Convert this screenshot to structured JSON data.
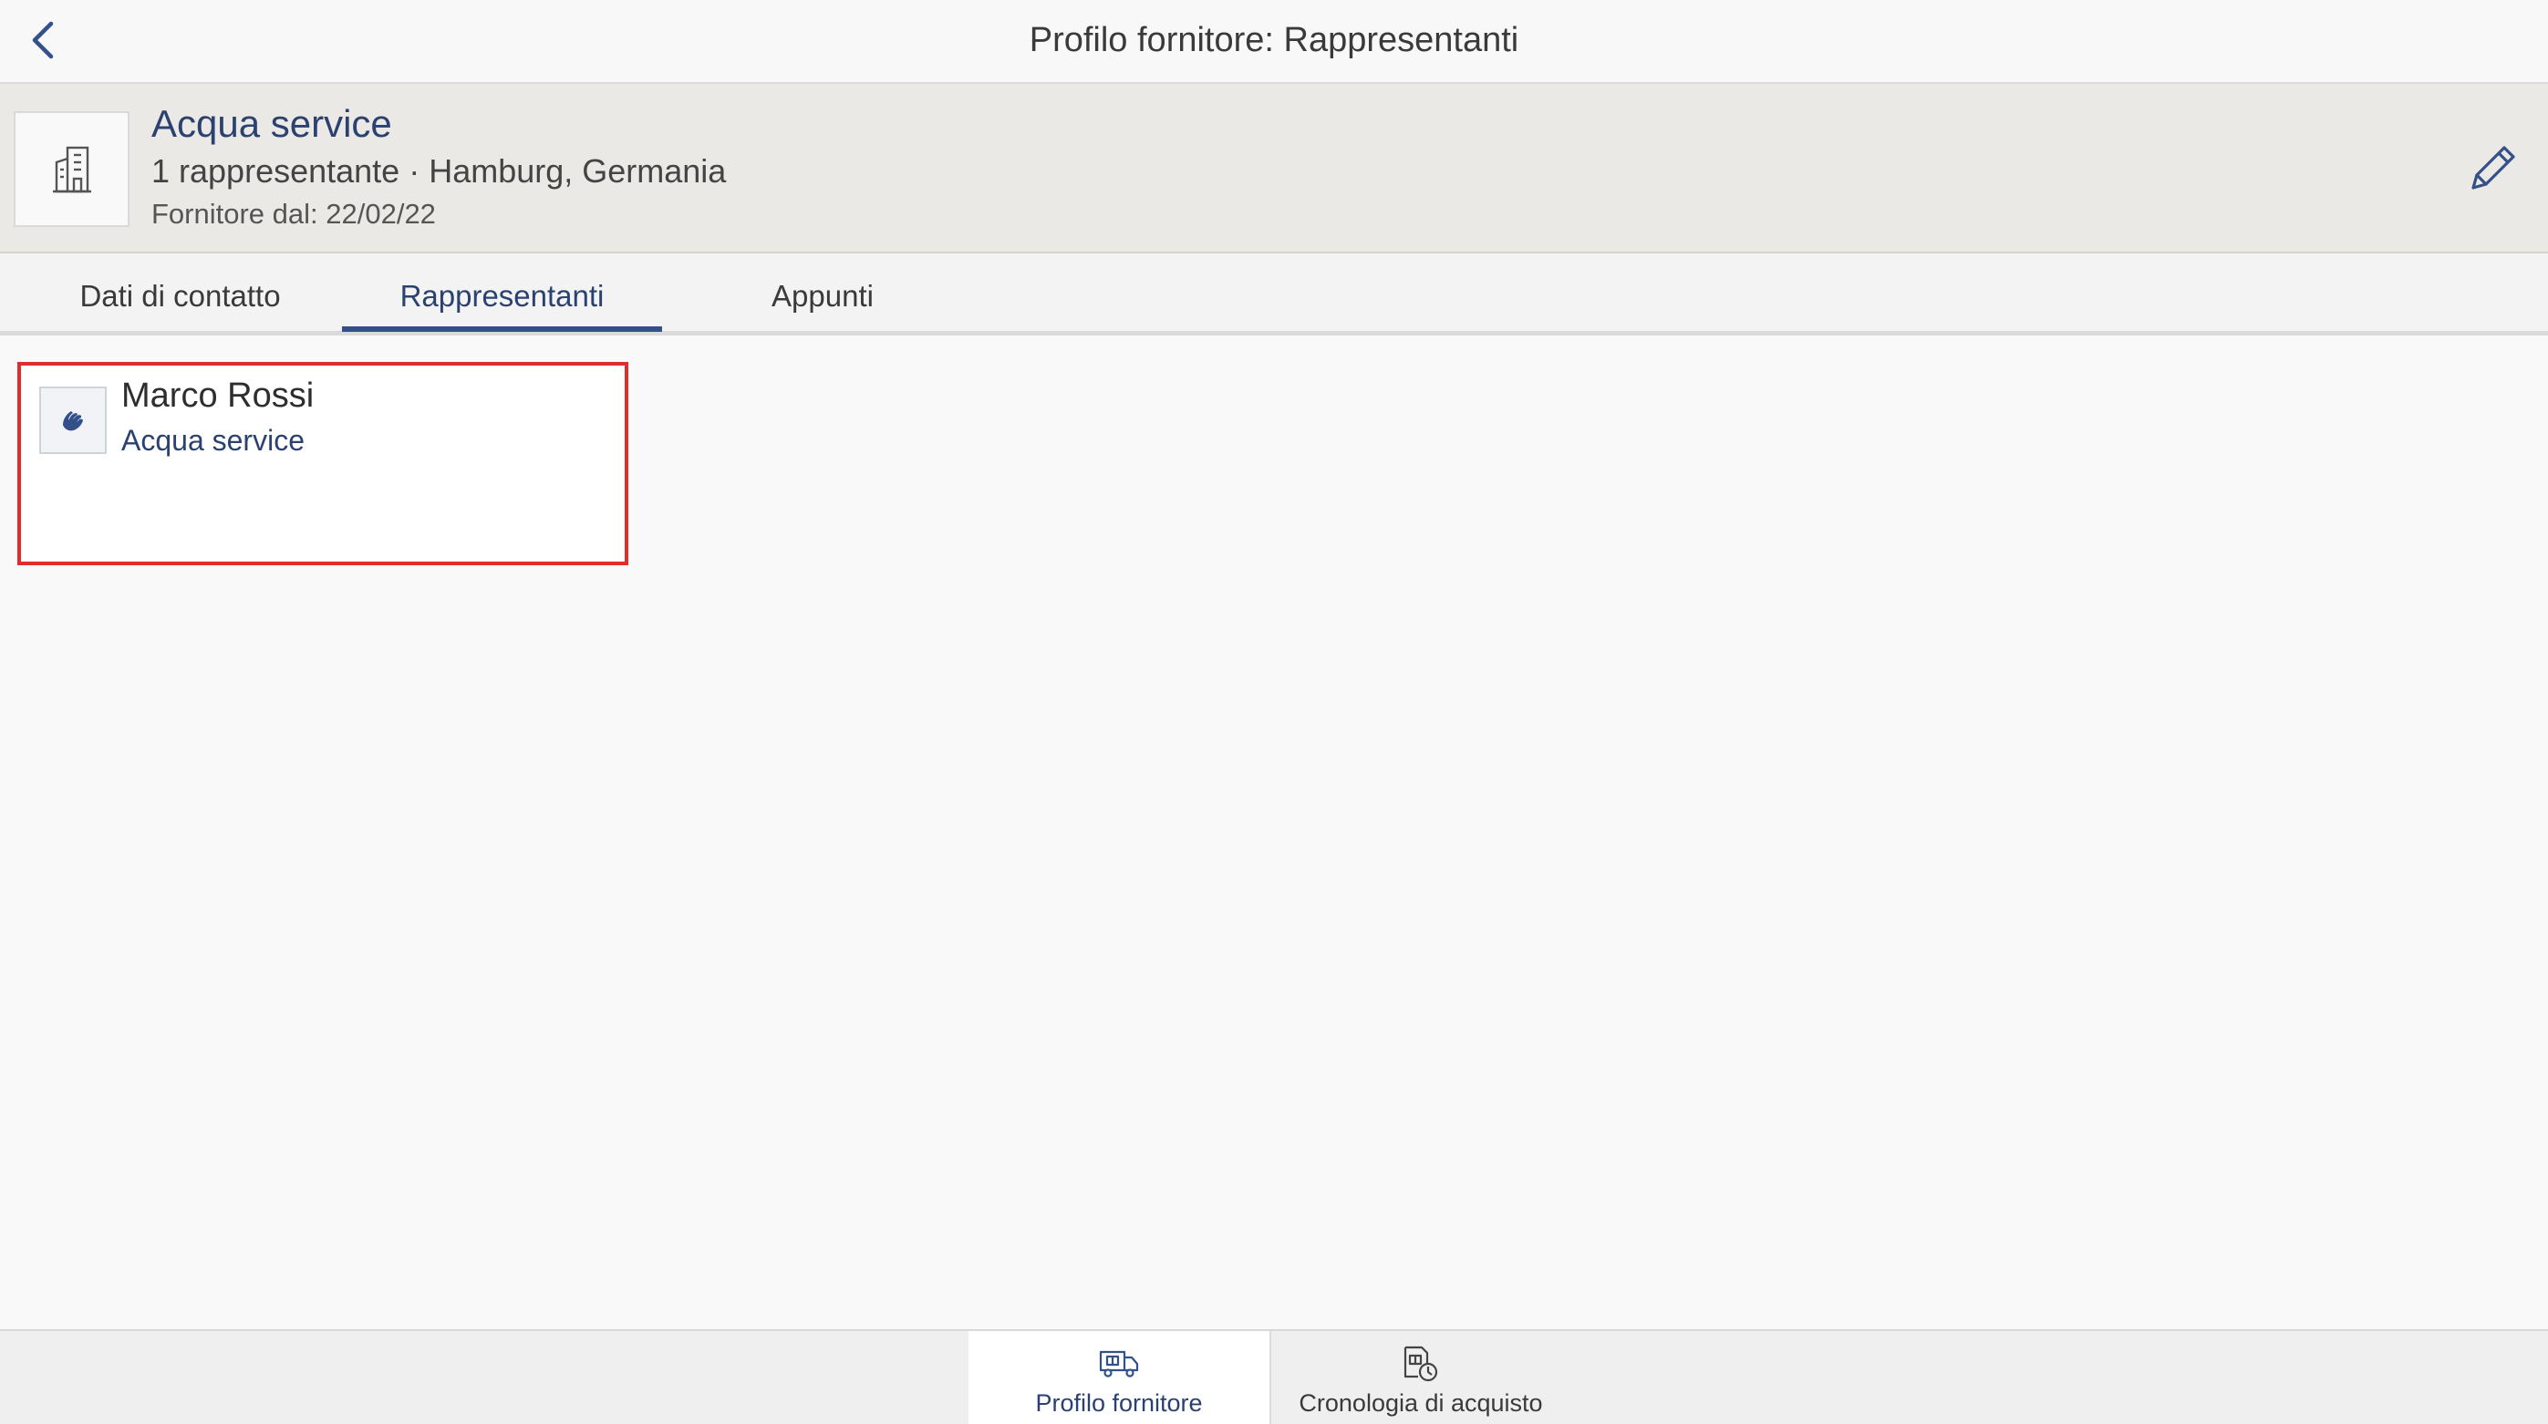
{
  "topbar": {
    "title": "Profilo fornitore: Rappresentanti",
    "back_icon": "chevron-left-icon"
  },
  "supplier": {
    "name": "Acqua service",
    "summary": "1 rappresentante · Hamburg, Germania",
    "since": "Fornitore dal: 22/02/22",
    "avatar_icon": "building-icon",
    "edit_icon": "pencil-icon"
  },
  "tabs": [
    {
      "label": "Dati di contatto",
      "active": false
    },
    {
      "label": "Rappresentanti",
      "active": true
    },
    {
      "label": "Appunti",
      "active": false
    }
  ],
  "representatives": [
    {
      "name": "Marco Rossi",
      "company": "Acqua service",
      "avatar_icon": "handshake-icon"
    }
  ],
  "bottom_nav": [
    {
      "label": "Profilo fornitore",
      "icon": "supplier-truck-icon",
      "active": true
    },
    {
      "label": "Cronologia di acquisto",
      "icon": "purchase-history-icon",
      "active": false
    }
  ],
  "colors": {
    "accent": "#2b4170",
    "tab_underline": "#34508a",
    "highlight_border": "#e22b2b",
    "header_bg": "#ebe9e6"
  }
}
